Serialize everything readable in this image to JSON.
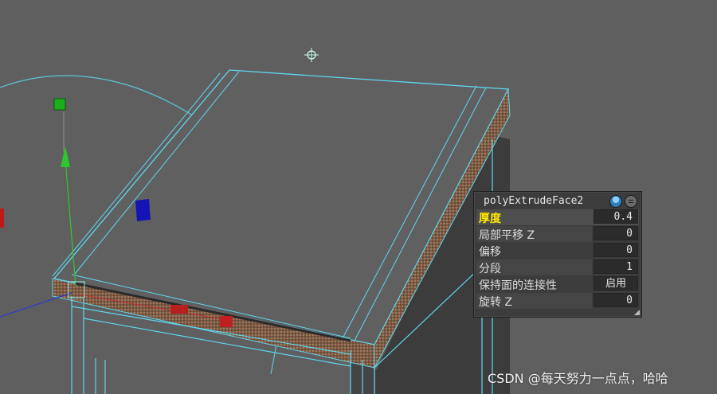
{
  "node_panel": {
    "title": "polyExtrudeFace2",
    "attributes": [
      {
        "label": "厚度",
        "value": "0.4"
      },
      {
        "label": "局部平移 Z",
        "value": "0"
      },
      {
        "label": "偏移",
        "value": "0"
      },
      {
        "label": "分段",
        "value": "1"
      },
      {
        "label": "保持面的连接性",
        "value": "启用"
      },
      {
        "label": "旋转 Z",
        "value": "0"
      }
    ]
  },
  "watermark": "CSDN @每天努力一点点，哈哈",
  "icons": [
    "light-icon",
    "pin-icon",
    "menu-icon",
    "resize-grip-icon"
  ],
  "colors": {
    "viewport_bg": "#5f5f5f",
    "wireframe": "#5fd7ef",
    "highlight_label": "#ffe600",
    "manip_y": "#2ec82e",
    "manip_z": "#1414b4",
    "manip_x": "#c01818"
  }
}
